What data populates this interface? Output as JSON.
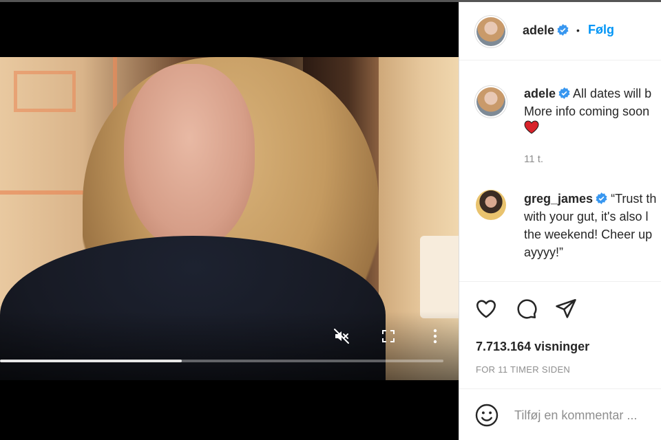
{
  "video": {
    "progress_fraction": 0.41,
    "controls": {
      "mute_icon": "speaker-muted-icon",
      "fullscreen_icon": "fullscreen-icon",
      "more_icon": "more-vertical-icon"
    }
  },
  "header": {
    "username": "adele",
    "verified": true,
    "separator": "•",
    "follow_label": "Følg"
  },
  "comments": [
    {
      "username": "adele",
      "verified": true,
      "lines": [
        "All dates will b",
        "More info coming soon",
        "❤️"
      ],
      "time": "11 t."
    },
    {
      "username": "greg_james",
      "verified": true,
      "lines": [
        "“Trust th",
        "with your gut, it's also l",
        "the weekend! Cheer up",
        "ayyyy!”"
      ]
    }
  ],
  "actions": {
    "like_icon": "heart-icon",
    "comment_icon": "comment-bubble-icon",
    "share_icon": "paper-plane-icon",
    "views": "7.713.164 visninger",
    "posted_ago": "FOR 11 TIMER SIDEN"
  },
  "add_comment": {
    "emoji_icon": "smiley-icon",
    "placeholder": "Tilføj en kommentar ..."
  },
  "colors": {
    "link_blue": "#0095f6",
    "verified_blue": "#3897f0",
    "heart_red": "#d8232a",
    "text": "#262626",
    "muted": "#8e8e8e"
  }
}
